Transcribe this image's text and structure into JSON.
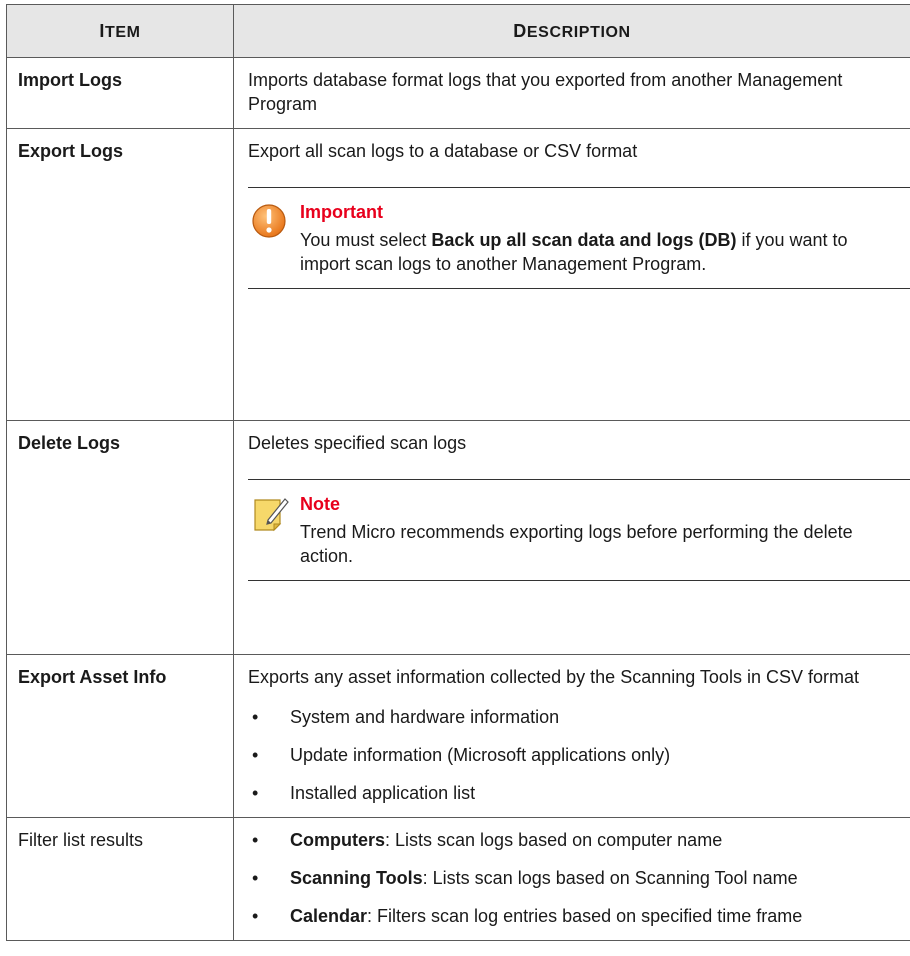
{
  "header": {
    "item_col": "Item",
    "desc_col": "Description"
  },
  "rows": [
    {
      "item": "Import Logs",
      "desc": "Imports database format logs that you exported from another Management Program"
    },
    {
      "item": "Export Logs",
      "desc": "Export all scan logs to a database or CSV format",
      "important": {
        "title": "Important",
        "text_before": "You must select ",
        "text_bold": "Back up all scan data and logs (DB)",
        "text_after": " if you want to import scan logs to another Management Program."
      }
    },
    {
      "item": "Delete Logs",
      "desc": "Deletes specified scan logs",
      "note": {
        "title": "Note",
        "text": "Trend Micro recommends exporting logs before performing the delete action."
      }
    },
    {
      "item": "Export Asset Info",
      "desc": "Exports any asset information collected by the Scanning Tools in CSV format",
      "bullets": [
        "System and hardware information",
        "Update information (Microsoft applications only)",
        "Installed application list"
      ]
    },
    {
      "item": "Filter list results",
      "bullets": [
        {
          "bold": "Computers",
          "rest": ": Lists scan logs based on computer name"
        },
        {
          "bold": "Scanning Tools",
          "rest": ": Lists scan logs based on Scanning Tool name"
        },
        {
          "bold": "Calendar",
          "rest": ": Filters scan log entries based on specified time frame"
        }
      ]
    }
  ],
  "colors": {
    "header_bg": "#e6e6e6",
    "admonition_title": "#e8001c",
    "important_icon": "#f08a1c",
    "note_icon": "#f5d66a"
  },
  "icons": {
    "important": "exclamation-circle-icon",
    "note": "note-pencil-icon"
  }
}
